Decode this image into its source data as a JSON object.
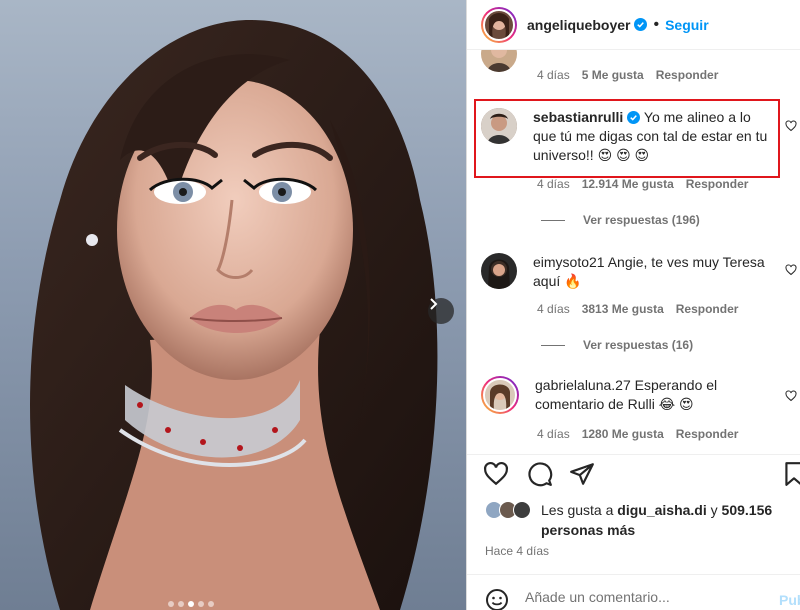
{
  "post": {
    "author": "angeliqueboyer",
    "separator": "•",
    "follow_label": "Seguir",
    "carousel_next_icon": "chevron-right-icon",
    "carousel_dots": 5,
    "carousel_active": 2
  },
  "comments": [
    {
      "username": "",
      "text": "",
      "age": "4 días",
      "likes": "5 Me gusta",
      "reply_label": "Responder"
    },
    {
      "username": "sebastianrulli",
      "verified": true,
      "text": "Yo me alineo a lo que tú me digas con tal de estar en tu universo!! 😍 😍 😍",
      "age": "4 días",
      "likes": "12.914 Me gusta",
      "reply_label": "Responder",
      "replies_label": "Ver respuestas (196)"
    },
    {
      "username": "eimysoto21",
      "text": "Angie, te ves muy Teresa aquí 🔥",
      "age": "4 días",
      "likes": "3813 Me gusta",
      "reply_label": "Responder",
      "replies_label": "Ver respuestas (16)"
    },
    {
      "username": "gabrielaluna.27",
      "text": "Esperando el comentario de Rulli 😂 😍",
      "age": "4 días",
      "likes": "1280 Me gusta",
      "reply_label": "Responder"
    }
  ],
  "likes_summary": {
    "prefix": "Les gusta a",
    "user": "digu_aisha.di",
    "connector": "y",
    "count": "509.156",
    "suffix": "personas más"
  },
  "time_ago": "Hace 4 días",
  "add_comment": {
    "placeholder": "Añade un comentario...",
    "publish_label": "Publica"
  },
  "colors": {
    "accent": "#0095f6",
    "highlight_box": "#e0161c",
    "muted": "#737373"
  }
}
